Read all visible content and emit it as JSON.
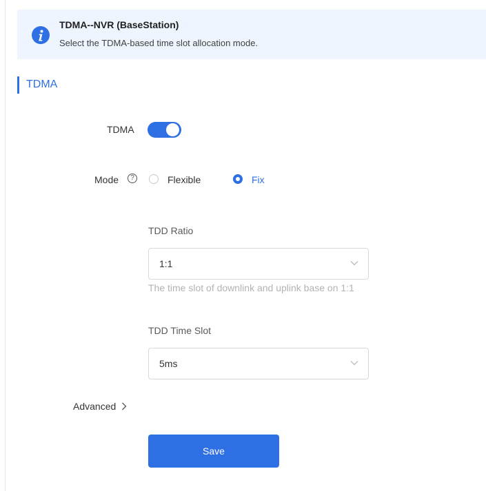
{
  "banner": {
    "title": "TDMA--NVR (BaseStation)",
    "description": "Select the TDMA-based time slot allocation mode.",
    "icon": "info-icon"
  },
  "section": {
    "title": "TDMA"
  },
  "form": {
    "tdma_label": "TDMA",
    "tdma_enabled": true,
    "mode_label": "Mode",
    "mode_help_icon": "question-circle-icon",
    "mode_options": [
      {
        "label": "Flexible",
        "selected": false
      },
      {
        "label": "Fix",
        "selected": true
      }
    ],
    "tdd_ratio": {
      "label": "TDD Ratio",
      "value": "1:1",
      "hint": "The time slot of downlink and uplink base on 1:1"
    },
    "tdd_time_slot": {
      "label": "TDD Time Slot",
      "value": "5ms"
    },
    "advanced_label": "Advanced",
    "save_label": "Save"
  },
  "colors": {
    "accent": "#2f6fe4",
    "banner_bg": "#eef5ff",
    "hint_text": "#b3b3b3"
  }
}
